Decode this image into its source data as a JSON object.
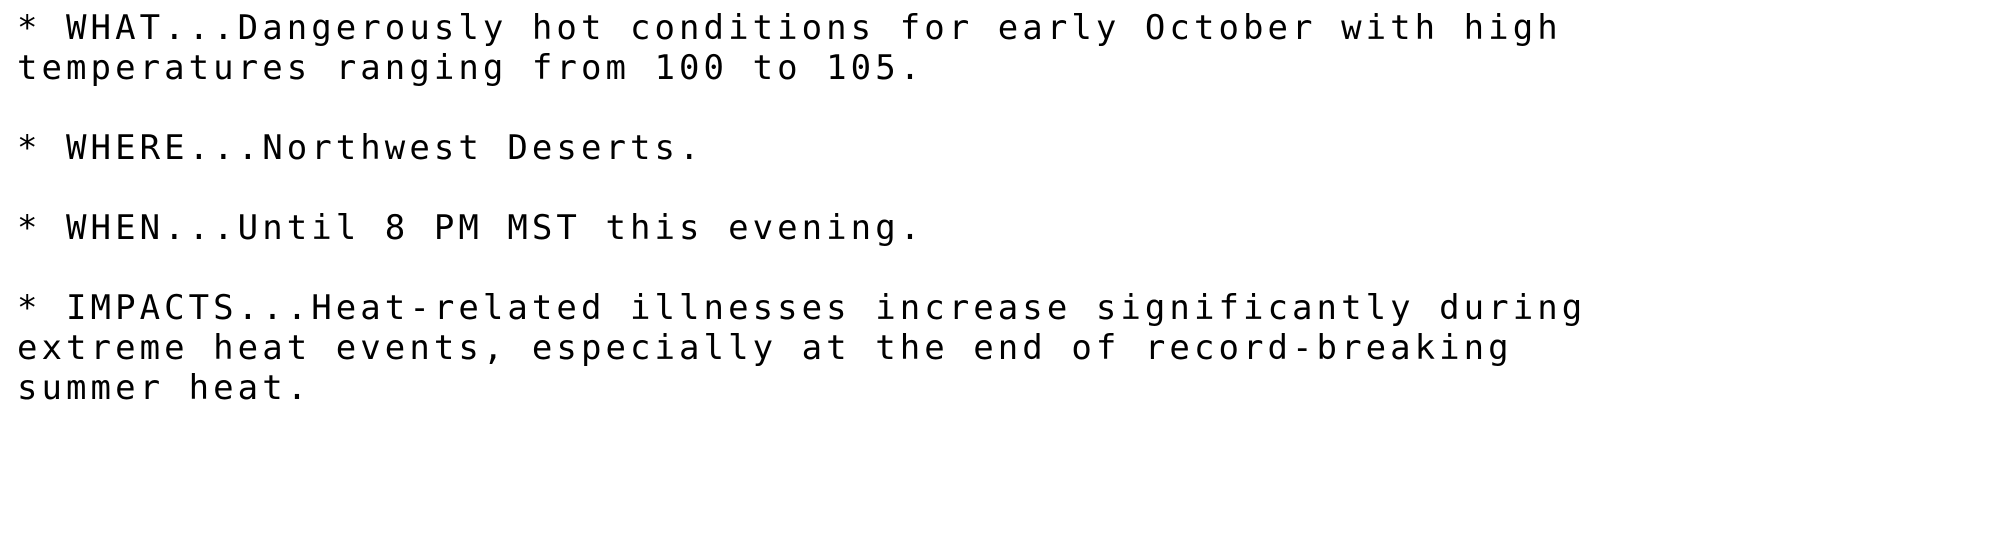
{
  "document": {
    "type": "weather-bulletin",
    "background_color": "#ffffff",
    "text_color": "#000000",
    "sections": [
      {
        "id": "what",
        "bullet": "*",
        "label": "WHAT",
        "lines": [
          "* WHAT...Dangerously hot conditions for early October with high",
          "temperatures ranging from 100 to 105."
        ]
      },
      {
        "id": "where",
        "bullet": "*",
        "label": "WHERE",
        "lines": [
          "* WHERE...Northwest Deserts."
        ]
      },
      {
        "id": "when",
        "bullet": "*",
        "label": "WHEN",
        "lines": [
          "* WHEN...Until 8 PM MST this evening."
        ]
      },
      {
        "id": "impacts",
        "bullet": "*",
        "label": "IMPACTS",
        "lines": [
          "* IMPACTS...Heat-related illnesses increase significantly during",
          "extreme heat events, especially at the end of record-breaking",
          "summer heat."
        ]
      }
    ],
    "rendered_lines": [
      "* WHAT...Dangerously hot conditions for early October with high",
      "temperatures ranging from 100 to 105.",
      "",
      "* WHERE...Northwest Deserts.",
      "",
      "* WHEN...Until 8 PM MST this evening.",
      "",
      "* IMPACTS...Heat-related illnesses increase significantly during",
      "extreme heat events, especially at the end of record-breaking",
      "summer heat."
    ],
    "details": {
      "high_temperature_low": "100",
      "high_temperature_high": "105",
      "month": "October",
      "area": "Northwest Deserts",
      "expiration_time": "8 PM MST",
      "expiration_day": "this evening"
    }
  }
}
